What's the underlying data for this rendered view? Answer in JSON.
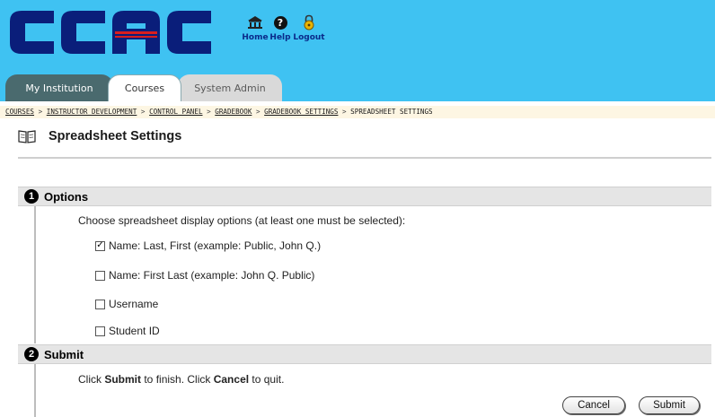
{
  "header": {
    "logo_text": "CCAC",
    "brand_colors": {
      "banner": "#3fc2f2",
      "logo": "#0a1e7a",
      "logo_accent": "#d81e1e"
    },
    "utility": [
      {
        "label": "Home",
        "icon": "home-icon"
      },
      {
        "label": "Help",
        "icon": "help-icon"
      },
      {
        "label": "Logout",
        "icon": "lock-icon"
      }
    ]
  },
  "tabs": [
    {
      "label": "My Institution",
      "active": false
    },
    {
      "label": "Courses",
      "active": true
    },
    {
      "label": "System Admin",
      "active": false
    }
  ],
  "breadcrumb": {
    "items": [
      "COURSES",
      "INSTRUCTOR DEVELOPMENT",
      "CONTROL PANEL",
      "GRADEBOOK",
      "GRADEBOOK SETTINGS",
      "SPREADSHEET SETTINGS"
    ],
    "separator": ">"
  },
  "page": {
    "title": "Spreadsheet Settings",
    "title_icon": "book-icon"
  },
  "steps": [
    {
      "number": "1",
      "title": "Options",
      "instruction": "Choose spreadsheet display options (at least one must be selected):",
      "options": [
        {
          "label": "Name: Last, First (example: Public, John Q.)",
          "checked": true
        },
        {
          "label": "Name: First Last (example: John Q. Public)",
          "checked": false
        },
        {
          "label": "Username",
          "checked": false
        },
        {
          "label": "Student ID",
          "checked": false
        }
      ]
    },
    {
      "number": "2",
      "title": "Submit",
      "instruction_parts": [
        "Click ",
        "Submit",
        " to finish. Click ",
        "Cancel",
        " to quit."
      ]
    }
  ],
  "buttons": {
    "cancel": "Cancel",
    "submit": "Submit"
  }
}
